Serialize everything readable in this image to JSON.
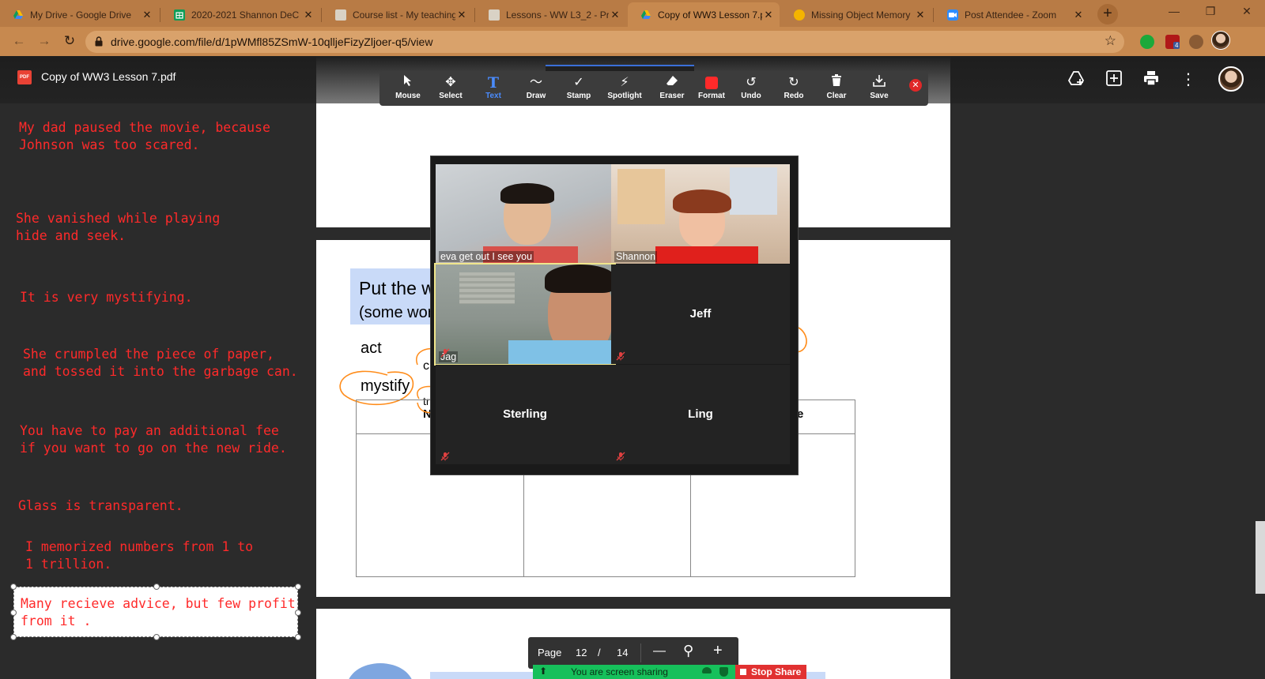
{
  "browser": {
    "tabs": [
      {
        "title": "My Drive - Google Drive",
        "favicon_color": "#fbbc04"
      },
      {
        "title": "2020-2021 Shannon DeC",
        "favicon_color": "#0f9d58"
      },
      {
        "title": "Course list - My teaching",
        "favicon_color": "#cfcfcf"
      },
      {
        "title": "Lessons - WW L3_2 - Pro",
        "favicon_color": "#cfcfcf"
      },
      {
        "title": "Copy of WW3 Lesson 7.p",
        "favicon_color": "#fbbc04"
      },
      {
        "title": "Missing Object Memory",
        "favicon_color": "#f4b400"
      },
      {
        "title": "Post Attendee - Zoom",
        "favicon_color": "#2d8cff"
      }
    ],
    "active_tab": 4,
    "tab_close": "✕",
    "new_tab": "+",
    "url": "drive.google.com/file/d/1pWMfl85ZSmW-10qlljeFizyZljoer-q5/view",
    "extension_badge": "4"
  },
  "viewer": {
    "file_icon": "PDF",
    "file_title": "Copy of WW3 Lesson 7.pdf"
  },
  "notes": [
    "My dad paused the movie, because\nJohnson was too scared.",
    "She vanished while playing\nhide and seek.",
    "It is very mystifying.",
    "She crumpled the piece of paper,\nand tossed it into the garbage can.",
    "You have to pay an additional fee\nif you want to go on the new ride.",
    "Glass is transparent.",
    "I memorized numbers from 1 to\n1 trillion.",
    "Many recieve advice, but few profit\nfrom it ."
  ],
  "pdf": {
    "heading_line1": "Put the w",
    "heading_line2": "(some wor",
    "word_act": "act",
    "word_mystify": "mystify",
    "fragment_c": "c",
    "fragment_tr": "tr",
    "fragment_n": "N",
    "fragment_e": "e"
  },
  "annotate_toolbar": {
    "tools": [
      "Mouse",
      "Select",
      "Text",
      "Draw",
      "Stamp",
      "Spotlight",
      "Eraser",
      "Format",
      "Undo",
      "Redo",
      "Clear",
      "Save"
    ],
    "active_tool": "Text"
  },
  "gallery": {
    "participants": [
      {
        "name": "eva get out I see you",
        "video": true,
        "muted": false
      },
      {
        "name": "Shannon",
        "video": true,
        "muted": false
      },
      {
        "name": "Jag",
        "video": true,
        "muted": true,
        "speaking": true
      },
      {
        "name": "Jeff",
        "video": false,
        "muted": true
      },
      {
        "name": "Sterling",
        "video": false,
        "muted": true
      },
      {
        "name": "Ling",
        "video": false,
        "muted": true
      }
    ]
  },
  "page_nav": {
    "label": "Page",
    "current": "12",
    "separator": "/",
    "total": "14",
    "zoom_out": "—",
    "zoom_in": "+"
  },
  "screen_share": {
    "status": "You are screen sharing",
    "stop_label": "Stop Share"
  }
}
